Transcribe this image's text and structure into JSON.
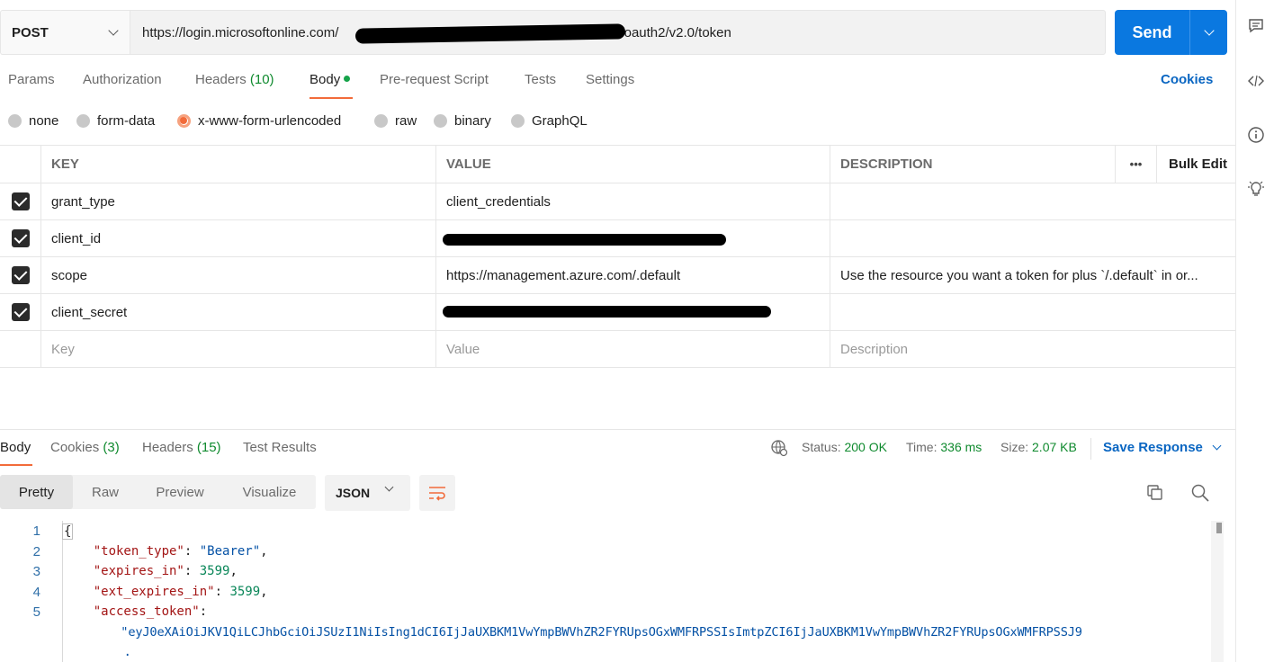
{
  "request": {
    "method": "POST",
    "url_prefix": "https://login.microsoftonline.com/",
    "url_suffix": "/oauth2/v2.0/token",
    "send_label": "Send"
  },
  "request_tabs": [
    {
      "label": "Params"
    },
    {
      "label": "Authorization"
    },
    {
      "label": "Headers",
      "count": "(10)"
    },
    {
      "label": "Body"
    },
    {
      "label": "Pre-request Script"
    },
    {
      "label": "Tests"
    },
    {
      "label": "Settings"
    }
  ],
  "cookies_link": "Cookies",
  "body_types": [
    "none",
    "form-data",
    "x-www-form-urlencoded",
    "raw",
    "binary",
    "GraphQL"
  ],
  "selected_body_type": "x-www-form-urlencoded",
  "params_table": {
    "headers": {
      "key": "KEY",
      "value": "VALUE",
      "description": "DESCRIPTION",
      "more": "•••",
      "bulk_edit": "Bulk Edit"
    },
    "rows": [
      {
        "key": "grant_type",
        "value": "client_credentials",
        "description": ""
      },
      {
        "key": "client_id",
        "value": "",
        "description": ""
      },
      {
        "key": "scope",
        "value": "https://management.azure.com/.default",
        "description": "Use the resource you want a token for plus `/.default` in or..."
      },
      {
        "key": "client_secret",
        "value": "",
        "description": ""
      }
    ],
    "placeholders": {
      "key": "Key",
      "value": "Value",
      "description": "Description"
    }
  },
  "response": {
    "tabs": [
      {
        "label": "Body"
      },
      {
        "label": "Cookies",
        "count": "(3)"
      },
      {
        "label": "Headers",
        "count": "(15)"
      },
      {
        "label": "Test Results"
      }
    ],
    "status_label": "Status:",
    "status_value": "200 OK",
    "time_label": "Time:",
    "time_value": "336 ms",
    "size_label": "Size:",
    "size_value": "2.07 KB",
    "save_label": "Save Response",
    "view_modes": [
      "Pretty",
      "Raw",
      "Preview",
      "Visualize"
    ],
    "format": "JSON",
    "line_numbers": [
      "1",
      "2",
      "3",
      "4",
      "5"
    ],
    "json": {
      "open_brace": "{",
      "token_type_key": "\"token_type\"",
      "token_type_value": "\"Bearer\"",
      "expires_in_key": "\"expires_in\"",
      "expires_in_value": "3599",
      "ext_expires_in_key": "\"ext_expires_in\"",
      "ext_expires_in_value": "3599",
      "access_token_key": "\"access_token\"",
      "access_token_value": "\"eyJ0eXAiOiJKV1QiLCJhbGciOiJSUzI1NiIsIng1dCI6IjJaUXBKM1VwYmpBWVhZR2FYRUpsOGxWMFRPSSIsImtpZCI6IjJaUXBKM1VwYmpBWVhZR2FYRUpsOGxWMFRPSSJ9",
      "access_token_cont": "."
    }
  }
}
